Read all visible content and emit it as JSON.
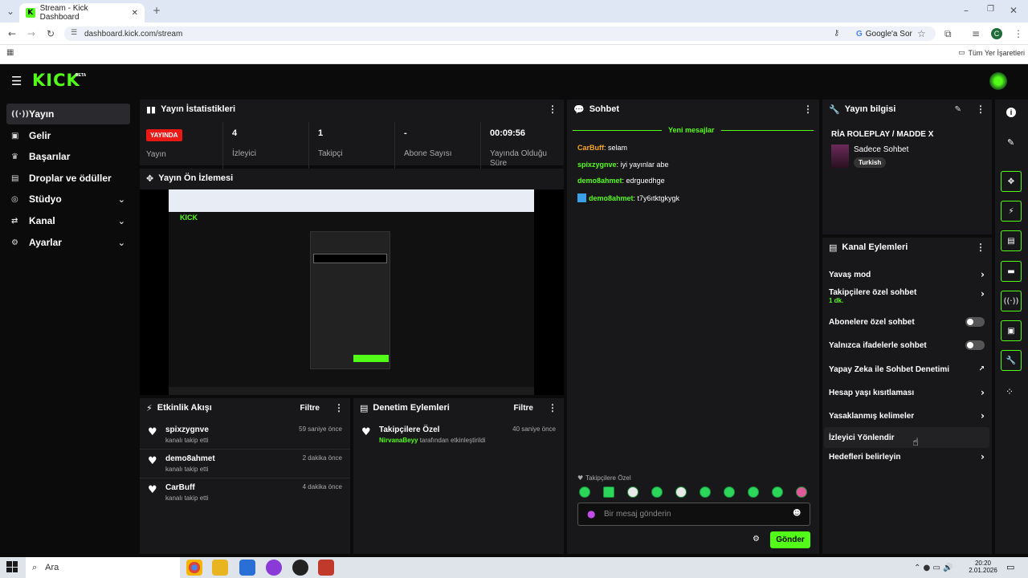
{
  "browser": {
    "tab_title": "Stream - Kick Dashboard",
    "url": "dashboard.kick.com/stream",
    "google_btn": "Google'a Sor",
    "bookmarks_label": "Tüm Yer İşaretleri",
    "profile_initial": "C"
  },
  "app": {
    "logo": "KICK",
    "beta": "BETA"
  },
  "nav": [
    {
      "label": "Yayın",
      "icon": "stream-icon"
    },
    {
      "label": "Gelir",
      "icon": "revenue-icon"
    },
    {
      "label": "Başarılar",
      "icon": "trophy-icon"
    },
    {
      "label": "Droplar ve ödüller",
      "icon": "gift-icon"
    },
    {
      "label": "Stüdyo",
      "icon": "studio-icon"
    },
    {
      "label": "Kanal",
      "icon": "channel-icon"
    },
    {
      "label": "Ayarlar",
      "icon": "settings-icon"
    }
  ],
  "stats": {
    "title": "Yayın İstatistikleri",
    "live_badge": "YAYINDA",
    "items": [
      {
        "label": "Yayın",
        "value": ""
      },
      {
        "label": "İzleyici",
        "value": "4"
      },
      {
        "label": "Takipçi",
        "value": "1"
      },
      {
        "label": "Abone Sayısı",
        "value": "-"
      },
      {
        "label": "Yayında Olduğu Süre",
        "value": "00:09:56"
      }
    ]
  },
  "preview": {
    "title": "Yayın Ön İzlemesi"
  },
  "activity": {
    "title": "Etkinlik Akışı",
    "filter": "Filtre",
    "items": [
      {
        "name": "spixzygnve",
        "sub": "kanalı takip etti",
        "time": "59 saniye önce"
      },
      {
        "name": "demo8ahmet",
        "sub": "kanalı takip etti",
        "time": "2 dakika önce"
      },
      {
        "name": "CarBuff",
        "sub": "kanalı takip etti",
        "time": "4 dakika önce"
      }
    ]
  },
  "moderation": {
    "title": "Denetim Eylemleri",
    "filter": "Filtre",
    "items": [
      {
        "title": "Takipçilere Özel",
        "user": "NirvanaBeyy",
        "rest": " tarafından etkinleştirildi",
        "time": "40 saniye önce"
      }
    ]
  },
  "chat": {
    "title": "Sohbet",
    "new_messages": "Yeni mesajlar",
    "messages": [
      {
        "user": "CarBuff",
        "text": ": selam"
      },
      {
        "user": "spixzygnve",
        "text": ": iyi yayınlar abe"
      },
      {
        "user": "demo8ahmet",
        "text": ": edrguedhge"
      },
      {
        "user": "demo8ahmet",
        "text": ": t7y6ıtktgkygk"
      }
    ],
    "followers_only": "Takipçilere Özel",
    "placeholder": "Bir mesaj gönderin",
    "send": "Gönder"
  },
  "stream_info": {
    "title": "Yayın bilgisi",
    "stream_title": "RİA ROLEPLAY / MADDE X",
    "category": "Sadece Sohbet",
    "language": "Turkish"
  },
  "channel_actions": {
    "title": "Kanal Eylemleri",
    "items": [
      {
        "label": "Yavaş mod",
        "kind": "arrow"
      },
      {
        "label": "Takipçilere özel sohbet",
        "sub": "1 dk.",
        "kind": "arrow"
      },
      {
        "label": "Abonelere özel sohbet",
        "kind": "toggle"
      },
      {
        "label": "Yalnızca ifadelerle sohbet",
        "kind": "toggle"
      },
      {
        "label": "Yapay Zeka ile Sohbet Denetimi",
        "kind": "external"
      },
      {
        "label": "Hesap yaşı kısıtlaması",
        "kind": "arrow"
      },
      {
        "label": "Yasaklanmış kelimeler",
        "kind": "arrow"
      },
      {
        "label": "İzleyici Yönlendir",
        "kind": "none"
      },
      {
        "label": "Hedefleri belirleyin",
        "kind": "arrow"
      }
    ]
  },
  "taskbar": {
    "search": "Ara",
    "time": "20:20",
    "date": "2.01.2026"
  },
  "colors": {
    "accent": "#53fc18",
    "live": "#e91916",
    "panel": "#18181b"
  }
}
